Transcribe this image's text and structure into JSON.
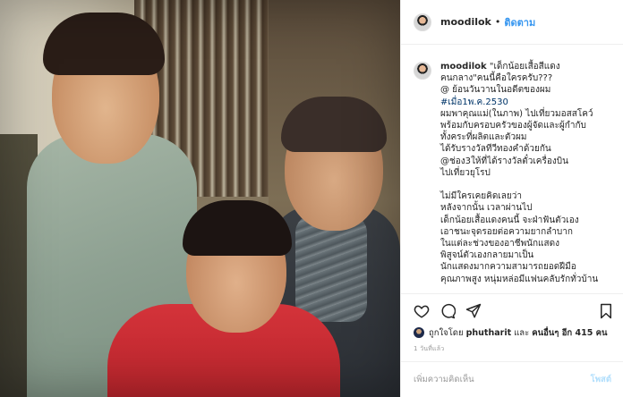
{
  "header": {
    "username": "moodilok",
    "separator": "•",
    "follow_label": "ติดตาม"
  },
  "caption": {
    "username": "moodilok",
    "lines": [
      "\"เด็กน้อยเสื้อสีแดง",
      "คนกลาง\"คนนี้คือใครครับ???",
      "@ ย้อนวันวานในอดีตของผม",
      "#เมื่อ1พ.ค.2530",
      "ผมพาคุณแม่(ในภาพ) ไปเที่ยวมอสสโคว์",
      "พร้อมกับครอบครัวของผู้จัดและผู้กำกับ",
      "ทั้งคระที่ผลิตและตัวผม",
      "ได้รับรางวัลทีวีทองคำด้วยกัน",
      "@ช่อง3ให้ที่ได้รางวัลตั๋วเครื่องบิน",
      "ไปเที่ยวยุโรป",
      "",
      "ไม่มีใครเคยคิดเลยว่า",
      "หลังจากนั้น เวลาผ่านไป",
      "เด็กน้อยเสื้อแดงคนนี้ จะฝ่าฟันตัวเอง",
      "เอาชนะจุดรอยต่อความยากลำบาก",
      "ในแต่ละช่วงของอาชีพนักแสดง",
      "พิสูจน์ตัวเองกลายมาเป็น",
      "นักแสดงมากความสามารถยอดฝีมือ",
      "คุณภาพสูง หนุ่มหล่อมีแฟนคลับรักทั่วบ้าน"
    ]
  },
  "actions": {
    "like_icon": "heart-icon",
    "comment_icon": "comment-icon",
    "share_icon": "share-icon",
    "save_icon": "bookmark-icon"
  },
  "likes": {
    "prefix": "ถูกใจโดย",
    "liker": "phutharit",
    "connector": "และ",
    "others": "คนอื่นๆ อีก 415 คน"
  },
  "time_ago": "1 วันที่แล้ว",
  "comment_box": {
    "placeholder": "เพิ่มความคิดเห็น",
    "post_label": "โพสต์"
  },
  "colors": {
    "link_blue": "#3897f0",
    "hashtag": "#003569",
    "post_disabled": "#b2dffc",
    "muted": "#999999"
  }
}
